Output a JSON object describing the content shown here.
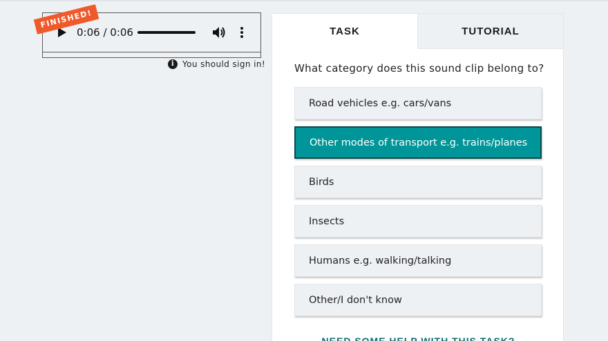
{
  "player": {
    "ribbon_label": "FINISHED!",
    "time_display": "0:06 / 0:06",
    "progress": 1.0,
    "icons": [
      "play-icon",
      "volume-icon",
      "more-vert-icon"
    ]
  },
  "signin": {
    "message": "You should sign in!",
    "icon": "info-icon"
  },
  "tabs": [
    {
      "label": "TASK",
      "active": true
    },
    {
      "label": "TUTORIAL",
      "active": false
    }
  ],
  "task": {
    "question": "What category does this sound clip belong to?",
    "options": [
      {
        "label": "Road vehicles e.g. cars/vans",
        "selected": false
      },
      {
        "label": "Other modes of transport e.g. trains/planes",
        "selected": true
      },
      {
        "label": "Birds",
        "selected": false
      },
      {
        "label": "Insects",
        "selected": false
      },
      {
        "label": "Humans e.g. walking/talking",
        "selected": false
      },
      {
        "label": "Other/I don't know",
        "selected": false
      }
    ],
    "help_link": "NEED SOME HELP WITH THIS TASK?"
  },
  "colors": {
    "accent": "#009699",
    "ribbon": "#f0592a",
    "background": "#eef1f4"
  }
}
